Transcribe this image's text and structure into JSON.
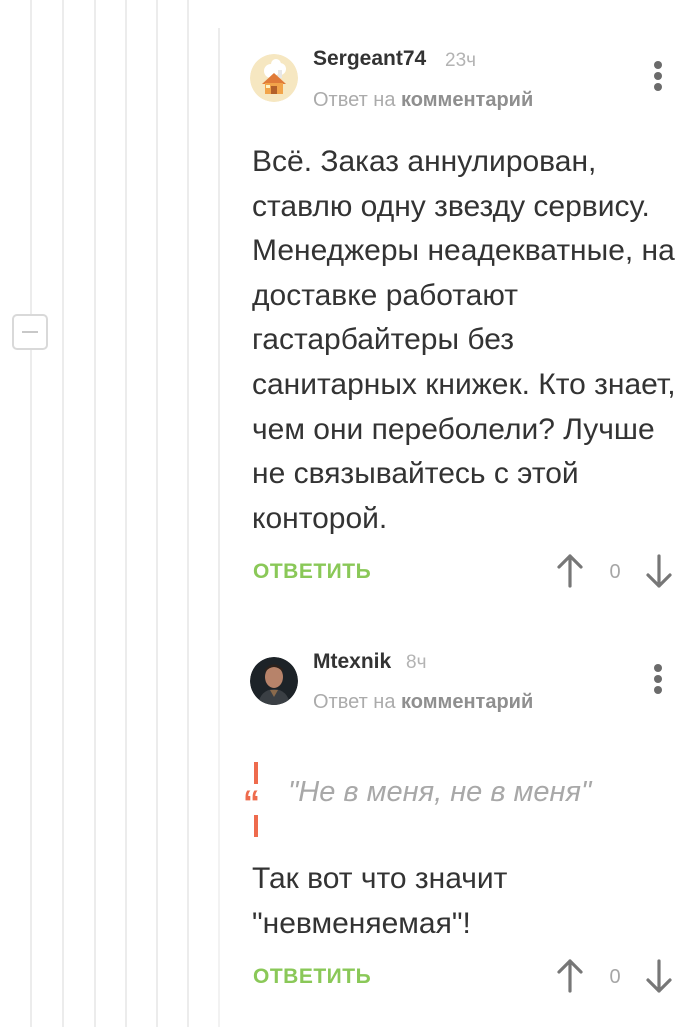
{
  "comments": [
    {
      "author": "Sergeant74",
      "time": "23ч",
      "reply_prefix": "Ответ на",
      "reply_target": "комментарий",
      "text": "Всё. Заказ аннулирован, ставлю одну звезду сервису. Менеджеры неадекватные, на доставке работают гастарбайтеры без санитарных книжек. Кто знает, чем они переболели? Лучше не связывайтесь с этой конторой.",
      "reply_label": "ОТВЕТИТЬ",
      "score": "0",
      "avatar_icon": "house-avatar-icon"
    },
    {
      "author": "Mtexnik",
      "time": "8ч",
      "reply_prefix": "Ответ на",
      "reply_target": "комментарий",
      "quote": "\"Не в меня, не в меня\"",
      "text": "Так вот что значит \"невменяемая\"!",
      "reply_label": "ОТВЕТИТЬ",
      "score": "0",
      "avatar_icon": "portrait-avatar-icon"
    }
  ],
  "colors": {
    "accent_green": "#8ac858",
    "quote_red": "#ee6b4d",
    "thread_line": "#ececec",
    "text": "#333333"
  },
  "icons": {
    "collapse": "minus-icon",
    "menu": "kebab-menu-icon",
    "upvote": "arrow-up-icon",
    "downvote": "arrow-down-icon",
    "quote": "quote-icon"
  }
}
